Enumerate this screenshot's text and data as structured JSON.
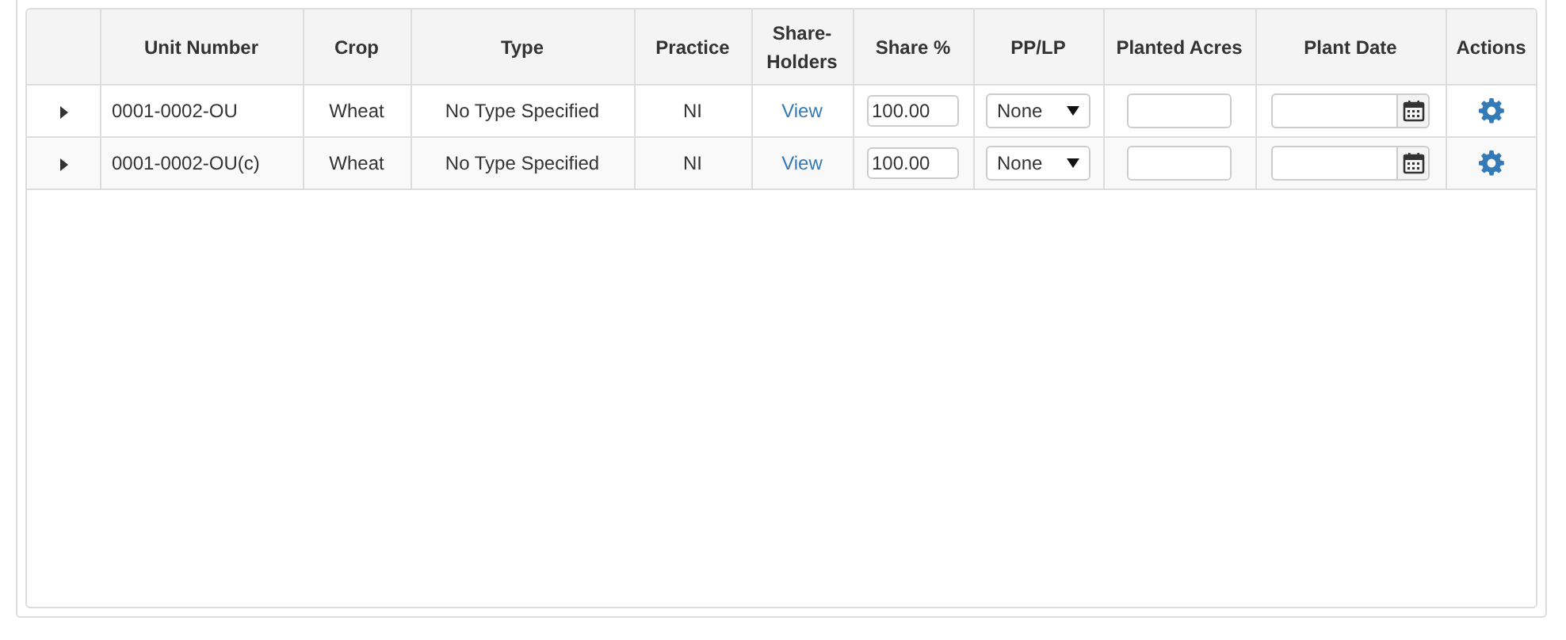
{
  "columns": [
    "Unit Number",
    "Crop",
    "Type",
    "Practice",
    "Share-\nHolders",
    "Share %",
    "PP/LP",
    "Planted Acres",
    "Plant Date",
    "Actions"
  ],
  "rows": [
    {
      "expanded": false,
      "unit_number": "0001-0002-OU",
      "crop": "Wheat",
      "type": "No Type Specified",
      "practice": "NI",
      "shareholders": "View",
      "share_percent": "100.00",
      "pp_lp": "None",
      "planted_acres": "",
      "plant_date": ""
    },
    {
      "expanded": false,
      "unit_number": "0001-0002-OU(c)",
      "crop": "Wheat",
      "type": "No Type Specified",
      "practice": "NI",
      "shareholders": "View",
      "share_percent": "100.00",
      "pp_lp": "None",
      "planted_acres": "",
      "plant_date": ""
    }
  ]
}
